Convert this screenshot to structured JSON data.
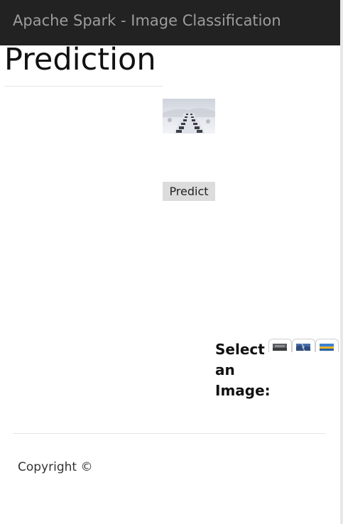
{
  "navbar": {
    "brand": "Apache Spark - Image Classification"
  },
  "main": {
    "title": "Prediction",
    "preview_image": "snowy-highway-traffic-photo",
    "predict_label": "Predict"
  },
  "selector": {
    "label": "Select an Image:",
    "thumbnails": [
      {
        "name": "dark-street-thumbnail"
      },
      {
        "name": "stormy-blue-thumbnail"
      },
      {
        "name": "sunset-landscape-thumbnail"
      }
    ]
  },
  "footer": {
    "copyright": "Copyright ©"
  },
  "colors": {
    "navbar_bg": "#222222",
    "navbar_text": "#9d9d9d",
    "button_bg": "#dcdcdc"
  }
}
